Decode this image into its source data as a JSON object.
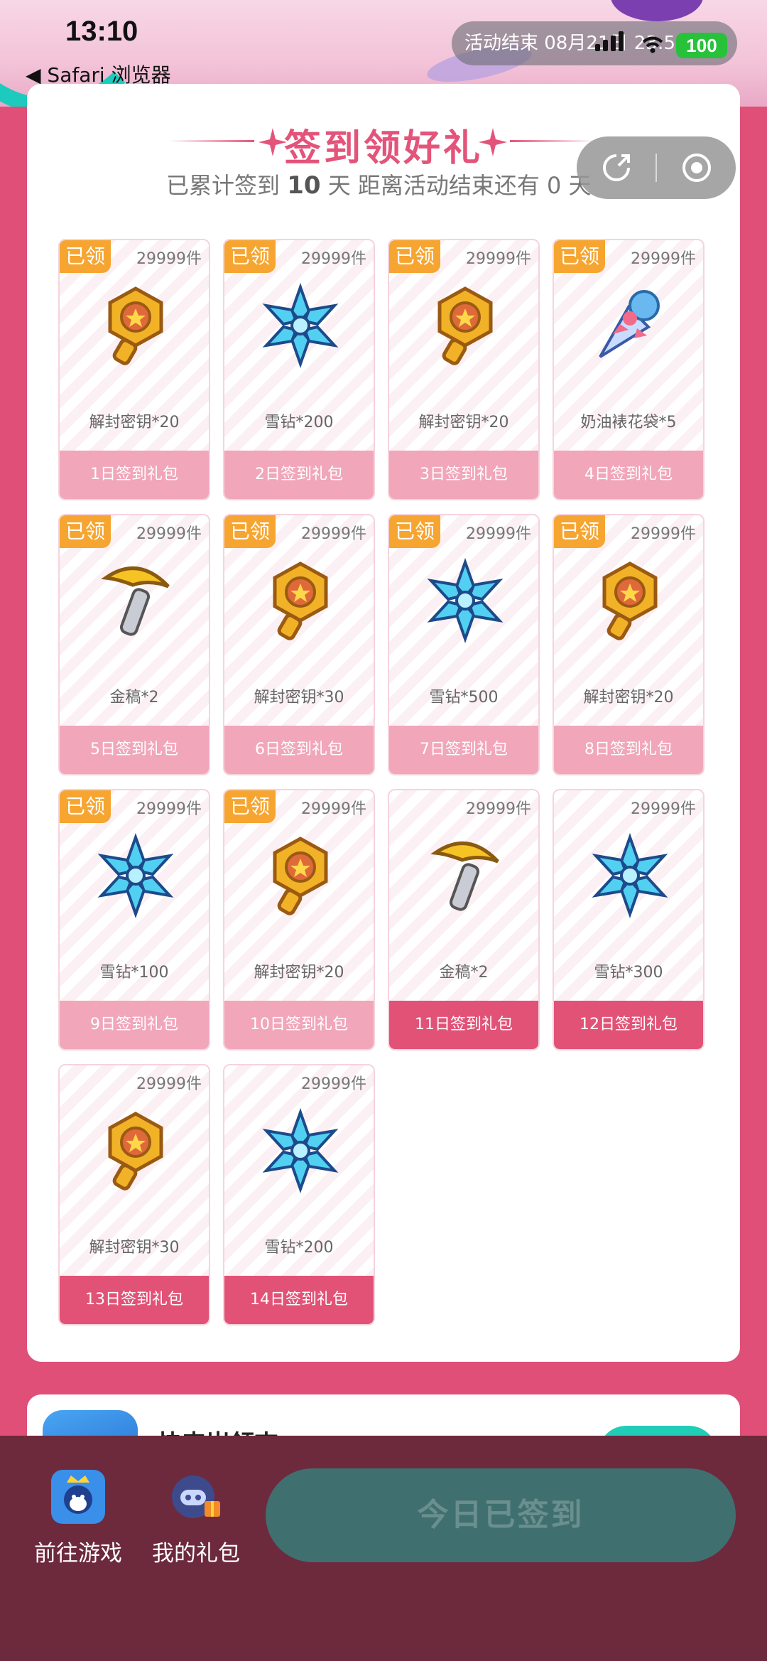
{
  "status_bar": {
    "time": "13:10",
    "back_label": "◀ Safari 浏览器",
    "battery": "100"
  },
  "activity_pill": {
    "text": "活动结束 08月21日 23:5"
  },
  "header": {
    "title": "签到领好礼",
    "subtitle_prefix": "已累计签到",
    "days_signed": "10",
    "subtitle_mid": "天  距离活动结束还有 0 天"
  },
  "mini_program_capsule": {
    "share_icon": "share-icon",
    "close_icon": "record-circle-icon"
  },
  "badge_text": "已领",
  "gifts": [
    {
      "stock": "29999件",
      "name": "解封密钥*20",
      "day": "1日签到礼包",
      "icon": "key",
      "claimed": true
    },
    {
      "stock": "29999件",
      "name": "雪钻*200",
      "day": "2日签到礼包",
      "icon": "snow",
      "claimed": true
    },
    {
      "stock": "29999件",
      "name": "解封密钥*20",
      "day": "3日签到礼包",
      "icon": "key",
      "claimed": true
    },
    {
      "stock": "29999件",
      "name": "奶油裱花袋*5",
      "day": "4日签到礼包",
      "icon": "cone",
      "claimed": true
    },
    {
      "stock": "29999件",
      "name": "金稿*2",
      "day": "5日签到礼包",
      "icon": "pick",
      "claimed": true
    },
    {
      "stock": "29999件",
      "name": "解封密钥*30",
      "day": "6日签到礼包",
      "icon": "key",
      "claimed": true
    },
    {
      "stock": "29999件",
      "name": "雪钻*500",
      "day": "7日签到礼包",
      "icon": "snow",
      "claimed": true
    },
    {
      "stock": "29999件",
      "name": "解封密钥*20",
      "day": "8日签到礼包",
      "icon": "key",
      "claimed": true
    },
    {
      "stock": "29999件",
      "name": "雪钻*100",
      "day": "9日签到礼包",
      "icon": "snow",
      "claimed": true
    },
    {
      "stock": "29999件",
      "name": "解封密钥*20",
      "day": "10日签到礼包",
      "icon": "key",
      "claimed": true
    },
    {
      "stock": "29999件",
      "name": "金稿*2",
      "day": "11日签到礼包",
      "icon": "pick",
      "claimed": false
    },
    {
      "stock": "29999件",
      "name": "雪钻*300",
      "day": "12日签到礼包",
      "icon": "snow",
      "claimed": false
    },
    {
      "stock": "29999件",
      "name": "解封密钥*30",
      "day": "13日签到礼包",
      "icon": "key",
      "claimed": false
    },
    {
      "stock": "29999件",
      "name": "雪钻*200",
      "day": "14日签到礼包",
      "icon": "snow",
      "claimed": false
    }
  ],
  "promo": {
    "title": "快来岁领吉"
  },
  "bottom_nav": {
    "game_label": "前往游戏",
    "gifts_label": "我的礼包",
    "signed_label": "今日已签到"
  },
  "colors": {
    "accent": "#e4537a",
    "badge": "#f6a531",
    "claimed_footer": "#f1a6ba",
    "open_footer": "#e25276",
    "bottom_bar": "#6d2a3d",
    "signed_button": "#3f706f"
  }
}
